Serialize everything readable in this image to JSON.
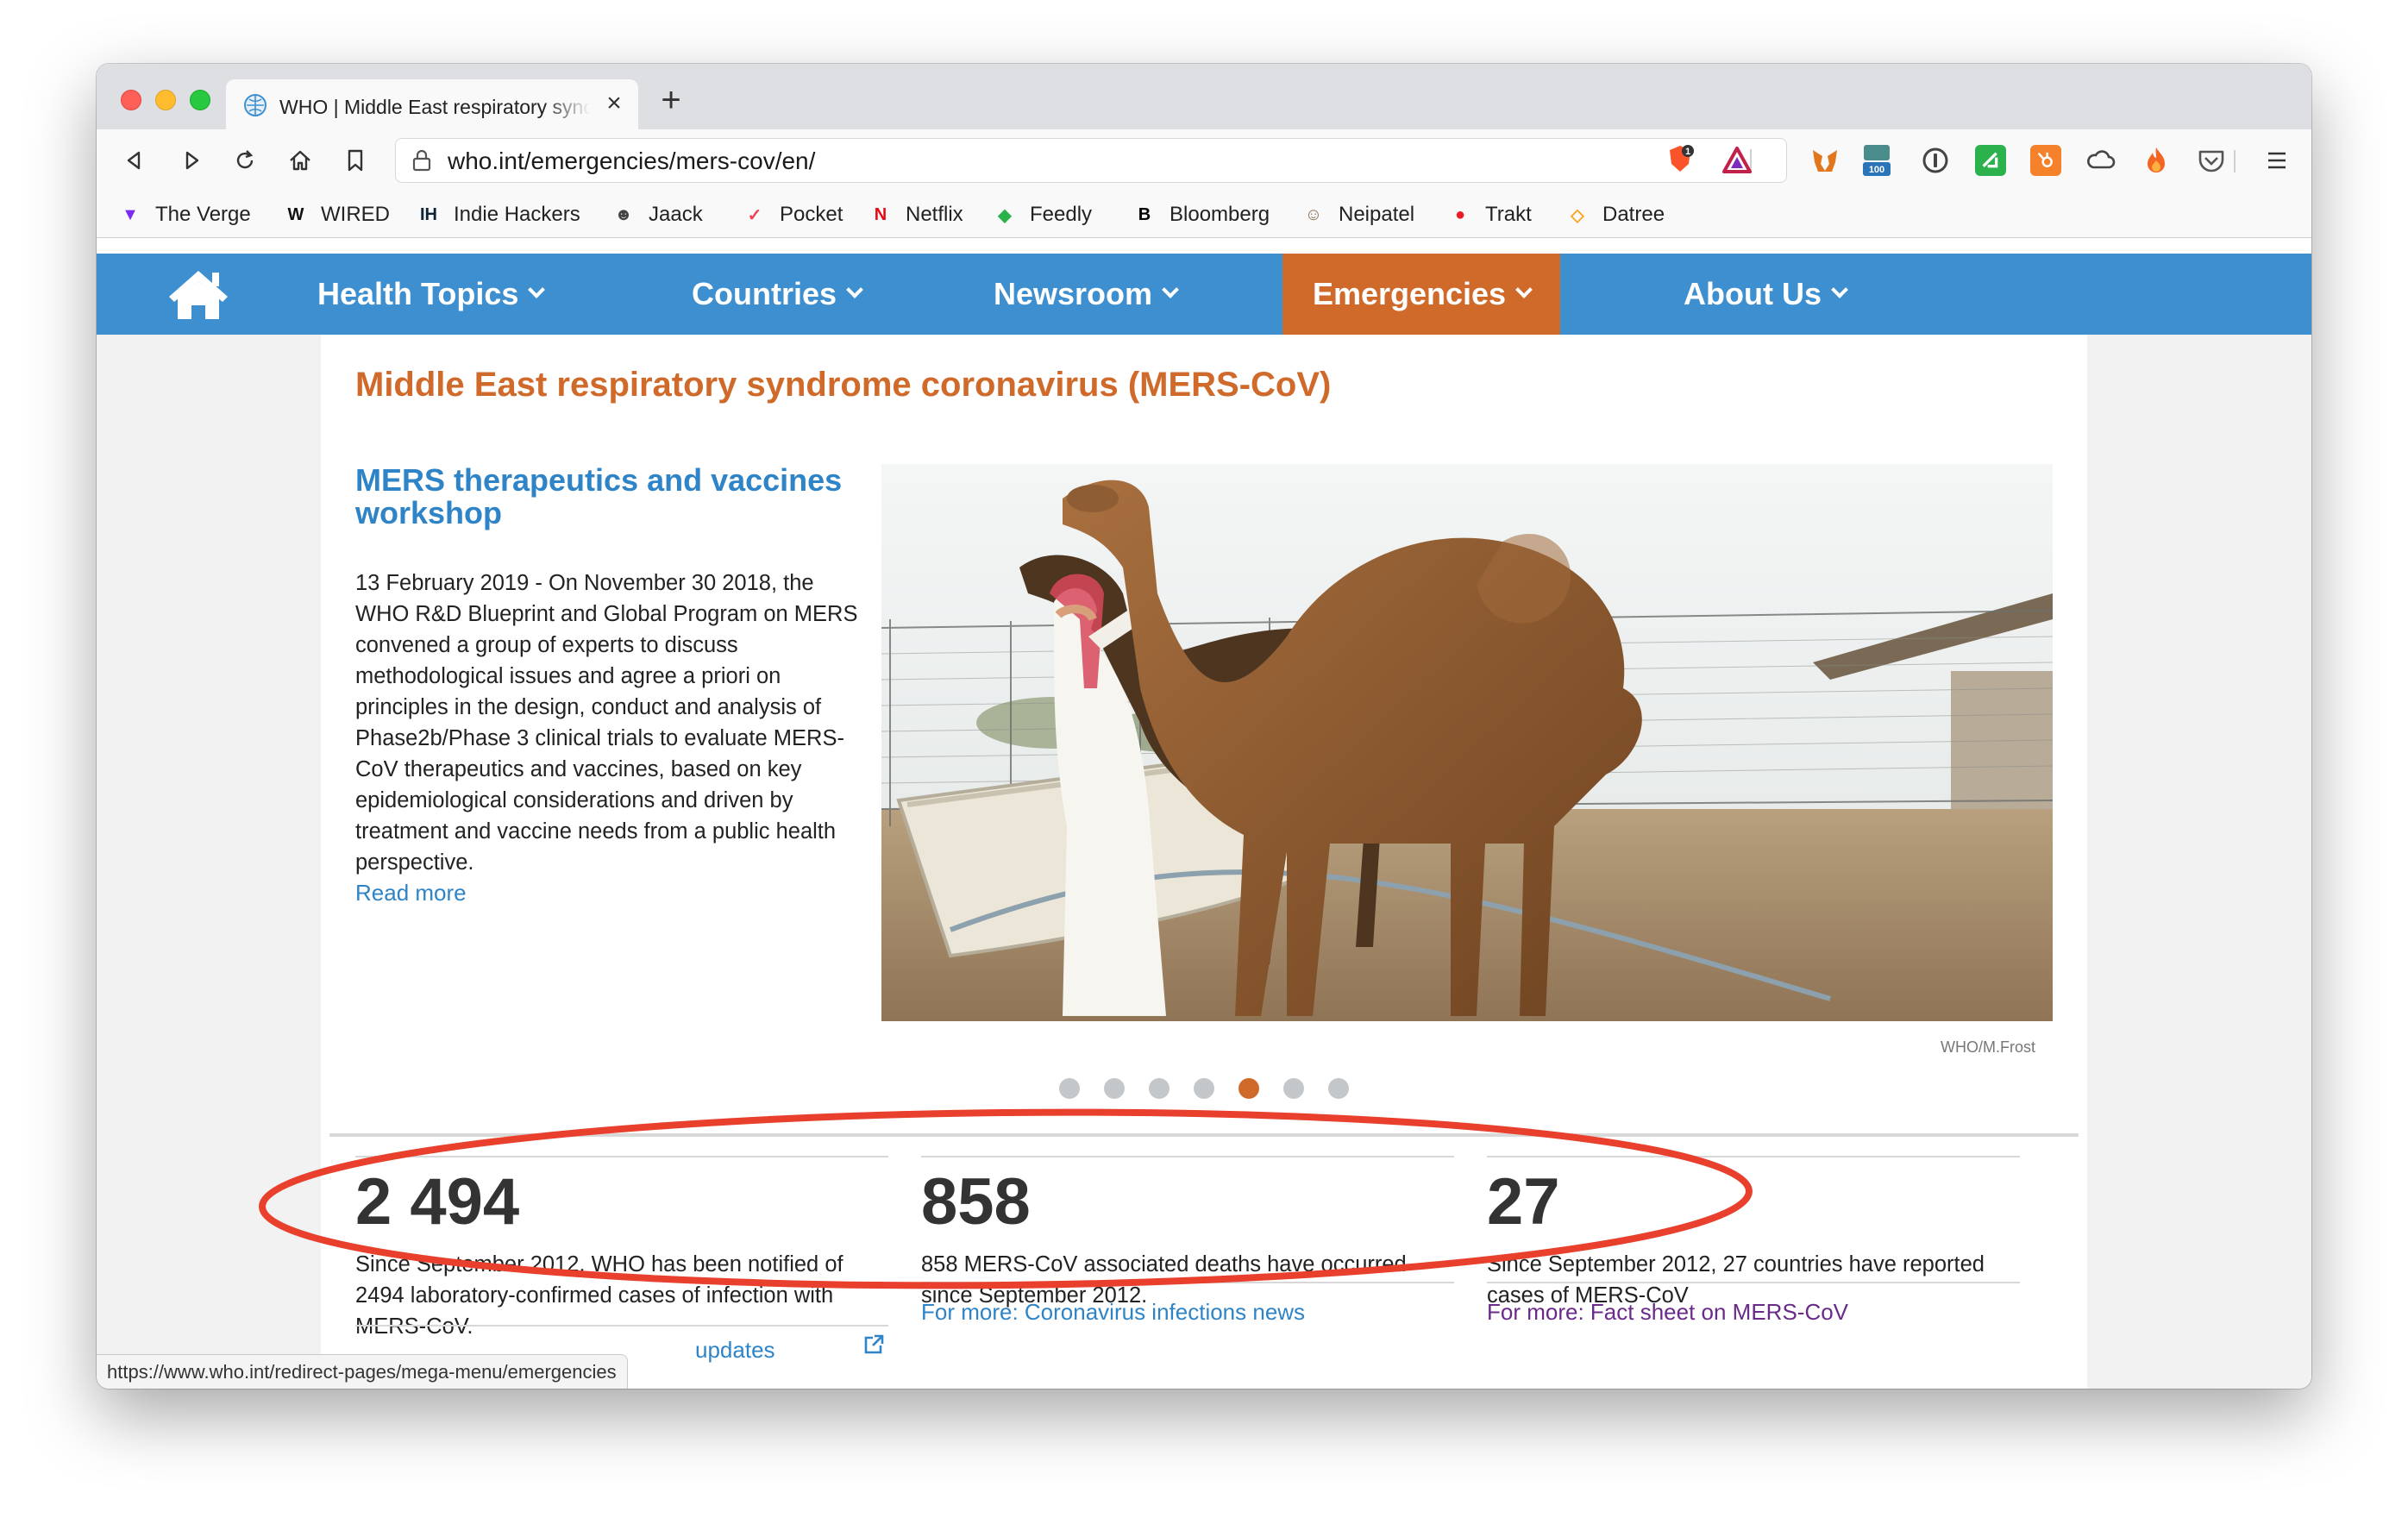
{
  "browser": {
    "tab_title": "WHO | Middle East respiratory syndrome coronavirus (MERS-CoV)",
    "tab_close": "×",
    "new_tab": "+",
    "url": "who.int/emergencies/mers-cov/en/",
    "status_url": "https://www.who.int/redirect-pages/mega-menu/emergencies",
    "extensions": [
      {
        "name": "brave-shield-icon",
        "badge": "1"
      },
      {
        "name": "triangle-icon"
      },
      {
        "name": "metamask-icon"
      },
      {
        "name": "bank-icon",
        "badge": "100"
      },
      {
        "name": "onepassword-icon"
      },
      {
        "name": "feedly-icon"
      },
      {
        "name": "hubspot-icon"
      },
      {
        "name": "cloud-icon"
      },
      {
        "name": "fire-icon"
      },
      {
        "name": "pocket-icon"
      }
    ]
  },
  "bookmarks": [
    {
      "label": "The Verge",
      "icon": "verge-icon",
      "glyph": "▼",
      "color": "#7b2cf2"
    },
    {
      "label": "WIRED",
      "icon": "wired-icon",
      "glyph": "W",
      "color": "#111111"
    },
    {
      "label": "Indie Hackers",
      "icon": "indie-hackers-icon",
      "glyph": "IH",
      "color": "#0e2439"
    },
    {
      "label": "Jaack",
      "icon": "jaack-icon",
      "glyph": "☻",
      "color": "#444444"
    },
    {
      "label": "Pocket",
      "icon": "pocket-icon",
      "glyph": "✓",
      "color": "#ef4056"
    },
    {
      "label": "Netflix",
      "icon": "netflix-icon",
      "glyph": "N",
      "color": "#e50914"
    },
    {
      "label": "Feedly",
      "icon": "feedly-icon",
      "glyph": "◆",
      "color": "#2bb24c"
    },
    {
      "label": "Bloomberg",
      "icon": "bloomberg-icon",
      "glyph": "B",
      "color": "#000000"
    },
    {
      "label": "Neipatel",
      "icon": "neipatel-icon",
      "glyph": "☺",
      "color": "#8a6a4a"
    },
    {
      "label": "Trakt",
      "icon": "trakt-icon",
      "glyph": "●",
      "color": "#ed1c24"
    },
    {
      "label": "Datree",
      "icon": "datree-icon",
      "glyph": "◇",
      "color": "#f5a623"
    }
  ],
  "nav": {
    "items": [
      "Health Topics",
      "Countries",
      "Newsroom",
      "Emergencies",
      "About Us"
    ]
  },
  "page": {
    "title": "Middle East respiratory syndrome coronavirus (MERS-CoV)",
    "article": {
      "title": "MERS therapeutics and vaccines workshop",
      "body": "13 February 2019 - On November 30 2018, the WHO R&D Blueprint and Global Program on MERS convened a group of experts to discuss methodological issues and agree a priori on principles in the design, conduct and analysis of Phase2b/Phase 3 clinical trials to evaluate MERS-CoV therapeutics and vaccines, based on key epidemiological considerations and driven by treatment and vaccine needs from a public health perspective.",
      "read_more": "Read more"
    },
    "photo_credit": "WHO/M.Frost",
    "carousel": {
      "count": 7,
      "active": 5
    },
    "stats": [
      {
        "number": "2 494",
        "text": "Since September 2012, WHO has been notified of 2494 laboratory-confirmed cases of infection with MERS-CoV.",
        "more": "updates"
      },
      {
        "number": "858",
        "text": "858 MERS-CoV associated deaths have occurred since September 2012.",
        "more": "For more: Coronavirus infections news"
      },
      {
        "number": "27",
        "text": "Since September 2012, 27 countries have reported cases of MERS-CoV",
        "more": "For more: Fact sheet on MERS-CoV"
      }
    ]
  },
  "colors": {
    "who_blue": "#3d8fcf",
    "who_orange": "#cf6a2b",
    "link_blue": "#2e84c6",
    "link_purple": "#6a2a8a",
    "annotation_red": "#e8402c"
  }
}
